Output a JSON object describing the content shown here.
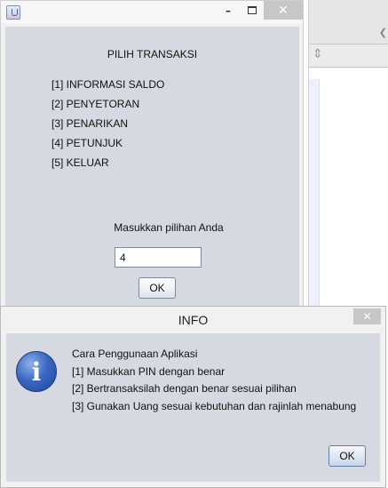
{
  "main_window": {
    "app_icon": "java-cup-icon",
    "controls": {
      "minimize": "–",
      "maximize_icon": "maximize-icon",
      "close": "✕"
    },
    "menu_title": "PILIH TRANSAKSI",
    "menu_items": [
      "[1] INFORMASI SALDO",
      "[2] PENYETORAN",
      "[3] PENARIKAN",
      "[4] PETUNJUK",
      "[5] KELUAR"
    ],
    "prompt": "Masukkan pilihan Anda",
    "input_value": "4",
    "ok_label": "OK"
  },
  "dialog": {
    "title": "INFO",
    "close": "✕",
    "icon": "info-icon",
    "icon_glyph": "i",
    "lines": [
      "Cara Penggunaan Aplikasi",
      "[1] Masukkan PIN dengan benar",
      "[2] Bertransaksilah dengan benar sesuai pilihan",
      "[3] Gunakan Uang sesuai kebutuhan dan rajinlah menabung"
    ],
    "ok_label": "OK"
  },
  "background": {
    "scroll_arrow": "❮",
    "drag_handle": "⇕"
  },
  "colors": {
    "panel_bg": "#d6d9df",
    "close_button": "#c7c7c7",
    "info_icon": "#3a69c2"
  }
}
